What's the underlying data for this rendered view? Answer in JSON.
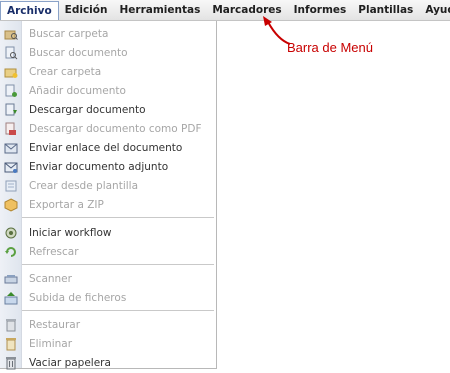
{
  "menubar": {
    "items": [
      {
        "label": "Archivo"
      },
      {
        "label": "Edición"
      },
      {
        "label": "Herramientas"
      },
      {
        "label": "Marcadores"
      },
      {
        "label": "Informes"
      },
      {
        "label": "Plantillas"
      },
      {
        "label": "Ayuda"
      }
    ]
  },
  "dropdown": {
    "items": [
      {
        "label": "Buscar carpeta",
        "enabled": false,
        "icon": "folder-search-icon"
      },
      {
        "label": "Buscar documento",
        "enabled": false,
        "icon": "document-search-icon"
      },
      {
        "label": "Crear carpeta",
        "enabled": false,
        "icon": "folder-add-icon"
      },
      {
        "label": "Añadir documento",
        "enabled": false,
        "icon": "document-add-icon"
      },
      {
        "label": "Descargar documento",
        "enabled": true,
        "icon": "document-download-icon"
      },
      {
        "label": "Descargar documento como PDF",
        "enabled": false,
        "icon": "pdf-download-icon"
      },
      {
        "label": "Enviar enlace del documento",
        "enabled": true,
        "icon": "send-link-icon"
      },
      {
        "label": "Enviar documento adjunto",
        "enabled": true,
        "icon": "send-attachment-icon"
      },
      {
        "label": "Crear desde plantilla",
        "enabled": false,
        "icon": "template-icon"
      },
      {
        "label": "Exportar a ZIP",
        "enabled": false,
        "icon": "zip-icon"
      },
      {
        "label": "Iniciar workflow",
        "enabled": true,
        "icon": "workflow-icon"
      },
      {
        "label": "Refrescar",
        "enabled": false,
        "icon": "refresh-icon"
      },
      {
        "label": "Scanner",
        "enabled": false,
        "icon": "scanner-icon"
      },
      {
        "label": "Subida de ficheros",
        "enabled": false,
        "icon": "upload-icon"
      },
      {
        "label": "Restaurar",
        "enabled": false,
        "icon": "restore-icon"
      },
      {
        "label": "Eliminar",
        "enabled": false,
        "icon": "delete-icon"
      },
      {
        "label": "Vaciar papelera",
        "enabled": true,
        "icon": "trash-icon"
      }
    ]
  },
  "annotation": {
    "text": "Barra de Menú",
    "color": "#c80000"
  }
}
